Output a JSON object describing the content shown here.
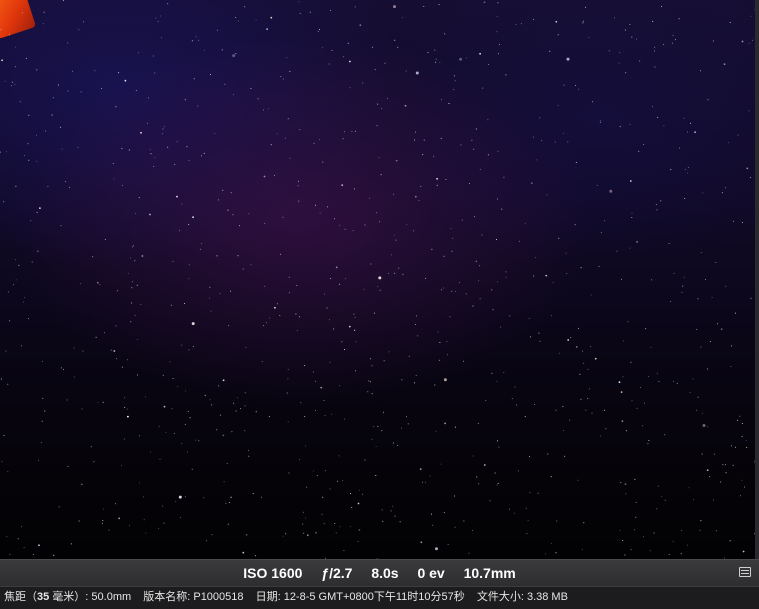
{
  "exif": {
    "iso": "ISO 1600",
    "aperture": "ƒ/2.7",
    "shutter": "8.0s",
    "exposure_bias": "0 ev",
    "focal_length": "10.7mm"
  },
  "metadata": {
    "focal_35_label_prefix": "焦距（",
    "focal_35_label_bold": "35",
    "focal_35_label_suffix": " 毫米）:",
    "focal_35_value": " 50.0mm",
    "version_label": "版本名称:",
    "version_value": " P1000518",
    "date_label": "日期:",
    "date_value": " 12-8-5 GMT+0800下午11时10分57秒",
    "size_label": "文件大小:",
    "size_value": " 3.38 MB"
  },
  "icons": {
    "info_toggle": "info-panel-icon"
  }
}
